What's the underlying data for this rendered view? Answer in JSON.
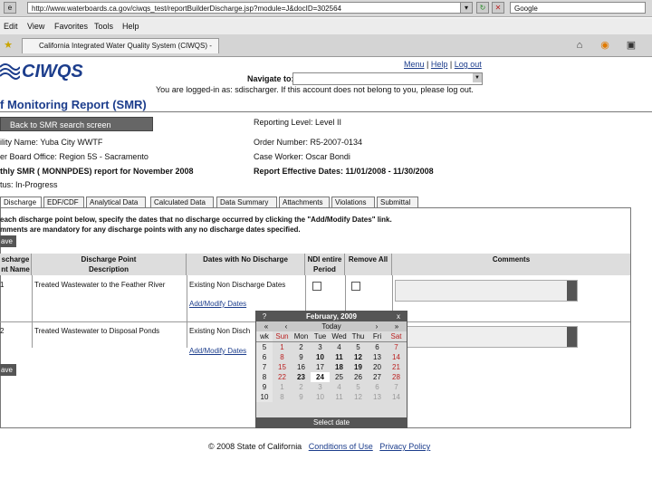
{
  "browser": {
    "url": "http://www.waterboards.ca.gov/ciwqs_test/reportBuilderDischarge.jsp?module=J&docID=302564",
    "search_value": "Google",
    "menu": [
      "Edit",
      "View",
      "Favorites",
      "Tools",
      "Help"
    ],
    "tab_title": "California Integrated Water Quality System (CIWQS) -"
  },
  "header": {
    "logo": "CIWQS",
    "links": {
      "menu": "Menu",
      "sep1": "|",
      "help": "Help",
      "sep2": "|",
      "logout": "Log out"
    },
    "navigate_label": "Navigate to:",
    "logged_in": "You are logged-in as: sdischarger. If this account does not belong to you, please log out.",
    "page_title": "f Monitoring Report (SMR)"
  },
  "report": {
    "back_button": "Back to SMR search screen",
    "facility": "ility Name: Yuba City WWTF",
    "regional_office": "er Board Office: Region 5S - Sacramento",
    "report_name": "thly SMR ( MONNPDES) report for November 2008",
    "status": "tus: In-Progress",
    "reporting_level": "Reporting Level: Level II",
    "order_number": "Order Number: R5-2007-0134",
    "case_worker": "Case Worker: Oscar Bondi",
    "effective_dates": "Report Effective Dates: 11/01/2008 - 11/30/2008"
  },
  "tabs": [
    "Discharge",
    "EDF/CDF",
    "Analytical Data",
    "Calculated Data",
    "Data Summary",
    "Attachments",
    "Violations",
    "Submittal"
  ],
  "instructions": {
    "line1": "each discharge point below, specify the dates that no discharge occurred by clicking the \"Add/Modify Dates\" link.",
    "line2": "mments are mandatory for any discharge points with any no discharge dates specified."
  },
  "save_label": "ave",
  "table": {
    "headers": {
      "point_name": "scharge\nnt Name",
      "description": "Discharge Point\nDescription",
      "no_discharge": "Dates with No Discharge",
      "ndi": "NDI entire\nPeriod",
      "remove_all": "Remove All",
      "comments": "Comments"
    },
    "rows": [
      {
        "point": "1",
        "description": "Treated Wastewater to the Feather River",
        "existing": "Existing Non Discharge Dates",
        "link": "Add/Modify Dates"
      },
      {
        "point": "2",
        "description": "Treated Wastewater to Disposal Ponds",
        "existing": "Existing Non Disch",
        "link": "Add/Modify Dates"
      }
    ]
  },
  "calendar": {
    "help": "?",
    "close": "x",
    "month_label": "February, 2009",
    "prev_year": "«",
    "prev_month": "‹",
    "today": "Today",
    "next_month": "›",
    "next_year": "»",
    "week_header": "wk",
    "days": [
      "Sun",
      "Mon",
      "Tue",
      "Wed",
      "Thu",
      "Fri",
      "Sat"
    ],
    "weeks": [
      {
        "wk": "5",
        "days": [
          "1",
          "2",
          "3",
          "4",
          "5",
          "6",
          "7"
        ]
      },
      {
        "wk": "6",
        "days": [
          "8",
          "9",
          "10",
          "11",
          "12",
          "13",
          "14"
        ]
      },
      {
        "wk": "7",
        "days": [
          "15",
          "16",
          "17",
          "18",
          "19",
          "20",
          "21"
        ]
      },
      {
        "wk": "8",
        "days": [
          "22",
          "23",
          "24",
          "25",
          "26",
          "27",
          "28"
        ]
      },
      {
        "wk": "9",
        "days": [
          "1",
          "2",
          "3",
          "4",
          "5",
          "6",
          "7"
        ]
      },
      {
        "wk": "10",
        "days": [
          "8",
          "9",
          "10",
          "11",
          "12",
          "13",
          "14"
        ]
      }
    ],
    "footer": "Select date"
  },
  "footer": {
    "copyright": "© 2008 State of California",
    "conditions": "Conditions of Use",
    "privacy": "Privacy Policy"
  }
}
